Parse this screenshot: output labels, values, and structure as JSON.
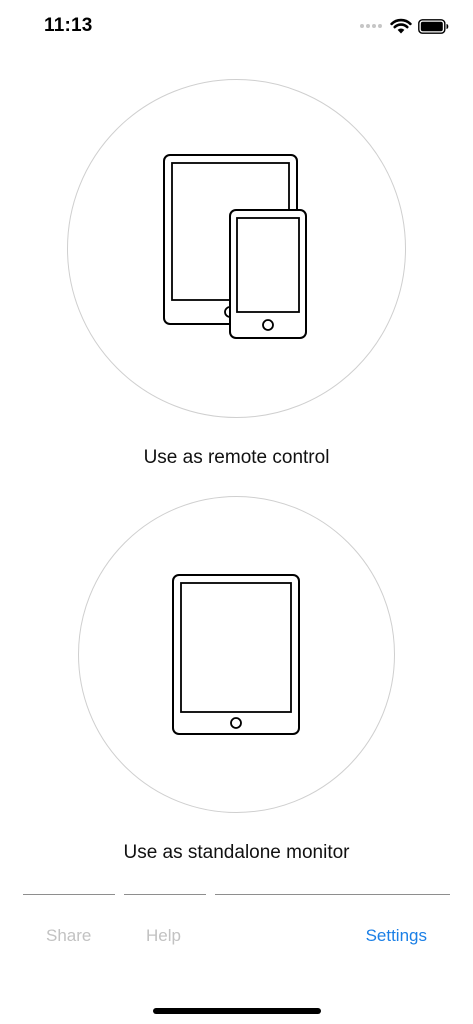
{
  "status_bar": {
    "time": "11:13",
    "icons": [
      "signal-dots-icon",
      "wifi-icon",
      "battery-icon"
    ]
  },
  "options": [
    {
      "label": "Use as remote control",
      "icon": "tablet-and-phone-icon"
    },
    {
      "label": "Use as standalone monitor",
      "icon": "tablet-icon"
    }
  ],
  "tabs": [
    {
      "label": "Share",
      "state": "disabled"
    },
    {
      "label": "Help",
      "state": "disabled"
    },
    {
      "label": "Settings",
      "state": "active"
    }
  ],
  "colors": {
    "accent": "#1a7fe6",
    "disabled": "#c2c2c2",
    "circle_border": "#cfcfcf"
  }
}
